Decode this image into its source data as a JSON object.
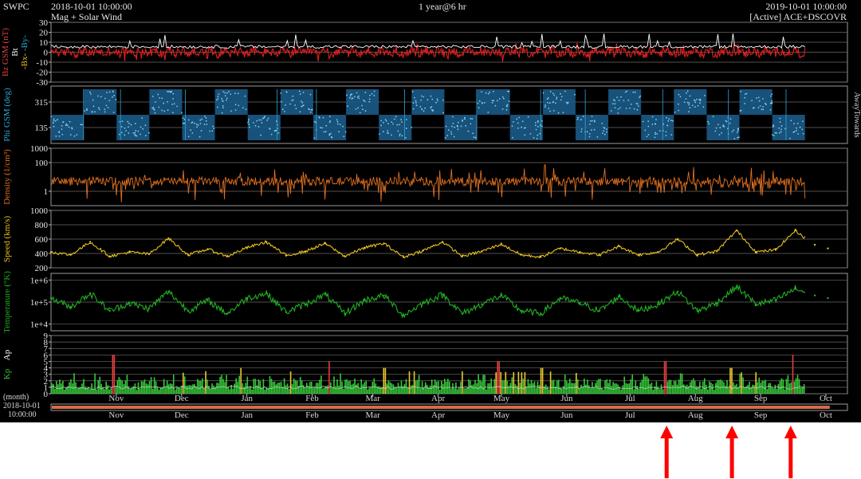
{
  "header": {
    "org": "SWPC",
    "start_time": "2018-10-01 10:00:00",
    "subtitle": "Mag + Solar Wind",
    "span": "1 year@6 hr",
    "end_time": "2019-10-01 10:00:00",
    "source": "[Active] ACE+DSCOVR"
  },
  "timeline": {
    "unit_label": "(month)",
    "start_date": "2018-10-01",
    "start_clock": "10:00:00"
  },
  "colors": {
    "background": "#000000",
    "bz": "#e02020",
    "bt": "#ffffff",
    "phi": "#2ea7d8",
    "density": "#e07020",
    "speed": "#e8c020",
    "temperature": "#22b022",
    "kp_quiet": "#36c83a",
    "kp_active": "#e8c830",
    "kp_storm": "#e04040",
    "annotation_arrow": "#ff0000"
  },
  "chart_data": [
    {
      "type": "line",
      "panel": "magnetic-field",
      "ylabel": "Bz GSM (nT)",
      "legend": [
        "Bt",
        "Bx",
        "By"
      ],
      "yticks": [
        "30",
        "20",
        "10",
        "0",
        "-10",
        "-20",
        "-30"
      ],
      "ylim": [
        -30,
        30
      ],
      "series": [
        {
          "name": "Bt",
          "description_values": "mostly 4-8 nT with spikes near 15-20 nT"
        },
        {
          "name": "Bz",
          "description_values": "fluctuating about 0, mostly within -10 to 10 nT"
        }
      ]
    },
    {
      "type": "scatter",
      "panel": "phi",
      "ylabel": "Phi GSM (deg)",
      "yticks": [
        "315",
        "135"
      ],
      "side_labels": [
        "Away",
        "Towards"
      ],
      "sector_sequence": [
        "towards",
        "away",
        "towards",
        "away",
        "towards",
        "away",
        "towards",
        "away",
        "towards",
        "away",
        "towards",
        "away",
        "towards",
        "away",
        "towards",
        "away",
        "towards",
        "away",
        "towards",
        "away",
        "towards",
        "away",
        "towards"
      ]
    },
    {
      "type": "line",
      "panel": "density",
      "ylabel": "Density (1/cm³)",
      "yticks": [
        "1000",
        "100",
        "1"
      ],
      "yscale": "log",
      "ylim": [
        0.1,
        1000
      ],
      "typical_value": 5
    },
    {
      "type": "line",
      "panel": "speed",
      "ylabel": "Speed (km/s)",
      "yticks": [
        "1000",
        "800",
        "600",
        "400",
        "200"
      ],
      "ylim": [
        200,
        1000
      ],
      "x_month": [
        0.0,
        0.3,
        0.6,
        0.9,
        1.2,
        1.5,
        1.8,
        2.1,
        2.4,
        2.7,
        3.0,
        3.3,
        3.6,
        3.9,
        4.2,
        4.5,
        4.8,
        5.1,
        5.4,
        5.7,
        6.0,
        6.3,
        6.6,
        6.9,
        7.2,
        7.5,
        7.8,
        8.1,
        8.4,
        8.7,
        9.0,
        9.3,
        9.6,
        9.9,
        10.2,
        10.5,
        10.8,
        11.1,
        11.4,
        11.7,
        11.9
      ],
      "values": [
        420,
        380,
        560,
        360,
        420,
        390,
        610,
        380,
        460,
        360,
        480,
        560,
        370,
        430,
        540,
        360,
        480,
        540,
        350,
        440,
        560,
        360,
        430,
        530,
        380,
        350,
        470,
        420,
        380,
        500,
        380,
        420,
        600,
        380,
        430,
        720,
        420,
        450,
        720,
        520,
        470
      ]
    },
    {
      "type": "line",
      "panel": "temperature",
      "ylabel": "Temperature (°K)",
      "yticks": [
        "1e+6",
        "1e+5",
        "1e+4"
      ],
      "yscale": "log",
      "ylim": [
        5000,
        2000000
      ],
      "x_month": [
        0.0,
        0.3,
        0.6,
        0.9,
        1.2,
        1.5,
        1.8,
        2.1,
        2.4,
        2.7,
        3.0,
        3.3,
        3.6,
        3.9,
        4.2,
        4.5,
        4.8,
        5.1,
        5.4,
        5.7,
        6.0,
        6.3,
        6.6,
        6.9,
        7.2,
        7.5,
        7.8,
        8.1,
        8.4,
        8.7,
        9.0,
        9.3,
        9.6,
        9.9,
        10.2,
        10.5,
        10.8,
        11.1,
        11.4,
        11.7,
        11.9
      ],
      "values": [
        150000,
        60000,
        250000,
        40000,
        90000,
        50000,
        300000,
        40000,
        120000,
        30000,
        150000,
        250000,
        35000,
        80000,
        220000,
        30000,
        120000,
        200000,
        25000,
        90000,
        220000,
        30000,
        80000,
        200000,
        40000,
        30000,
        150000,
        90000,
        40000,
        180000,
        40000,
        80000,
        300000,
        40000,
        90000,
        500000,
        80000,
        120000,
        400000,
        200000,
        150000
      ]
    },
    {
      "type": "bar",
      "panel": "kp-ap",
      "ylabel_kp": "Kp",
      "ylabel_ap": "Ap",
      "yticks": [
        "9",
        "8",
        "7",
        "6",
        "5",
        "4",
        "3",
        "2",
        "1",
        "0"
      ],
      "ylim": [
        0,
        9
      ],
      "typical_kp": 1.5,
      "storm_peaks": [
        {
          "month": 0.95,
          "kp": 6
        },
        {
          "month": 2.9,
          "kp": 4
        },
        {
          "month": 4.25,
          "kp": 5
        },
        {
          "month": 5.1,
          "kp": 4
        },
        {
          "month": 6.85,
          "kp": 5
        },
        {
          "month": 7.5,
          "kp": 4
        },
        {
          "month": 9.4,
          "kp": 5
        },
        {
          "month": 10.4,
          "kp": 4
        },
        {
          "month": 11.35,
          "kp": 6
        }
      ]
    }
  ],
  "x_axis": {
    "months": [
      "Nov",
      "Dec",
      "Jan",
      "Feb",
      "Mar",
      "Apr",
      "May",
      "Jun",
      "Jul",
      "Aug",
      "Sep",
      "Oct"
    ],
    "month_offsets": [
      1.0,
      2.0,
      3.0,
      4.0,
      4.93,
      5.93,
      6.9,
      7.9,
      8.87,
      9.87,
      10.87,
      11.87
    ]
  },
  "annotations": {
    "arrows_at_month": [
      9.43,
      10.43,
      11.33
    ]
  }
}
